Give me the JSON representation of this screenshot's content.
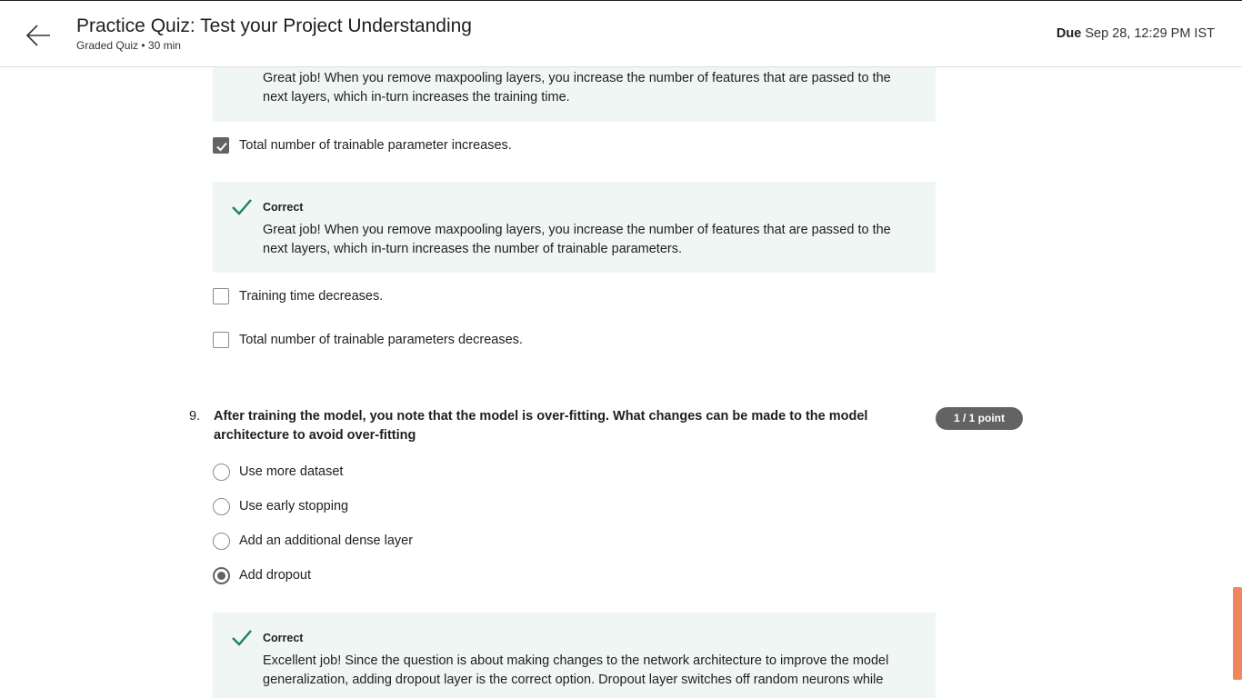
{
  "header": {
    "title": "Practice Quiz: Test your Project Understanding",
    "subtitle": "Graded Quiz • 30 min",
    "due_label": "Due",
    "due_value": "Sep 28, 12:29 PM IST",
    "back_icon": "arrow-left-icon"
  },
  "question8": {
    "top_feedback_text": "Great job! When you remove maxpooling layers, you increase the number of features that are passed to the next layers, which in-turn increases the training time.",
    "options": [
      {
        "label": "Total number of trainable parameter increases.",
        "checked": true
      },
      {
        "label": "Training time decreases.",
        "checked": false
      },
      {
        "label": "Total number of trainable parameters decreases.",
        "checked": false
      }
    ],
    "feedback": {
      "label": "Correct",
      "text": "Great job! When you remove maxpooling layers, you increase the number of features that are passed to the next layers, which in-turn increases the number of trainable parameters."
    }
  },
  "question9": {
    "number": "9.",
    "text": "After training the model, you note that the model is over-fitting. What changes can be made to the model architecture to avoid over-fitting",
    "points": "1 / 1 point",
    "options": [
      {
        "label": "Use more dataset",
        "selected": false
      },
      {
        "label": "Use early stopping",
        "selected": false
      },
      {
        "label": "Add an additional dense layer",
        "selected": false
      },
      {
        "label": "Add dropout",
        "selected": true
      }
    ],
    "feedback": {
      "label": "Correct",
      "text": "Excellent job! Since the question is about making changes to the network architecture to improve the model generalization, adding dropout layer is the correct option. Dropout layer switches off random neurons while"
    }
  },
  "colors": {
    "feedback_bg": "#f0f6f3",
    "check_green": "#1f8354",
    "badge_gray": "#636363",
    "scroll_thumb": "#f0875c"
  }
}
